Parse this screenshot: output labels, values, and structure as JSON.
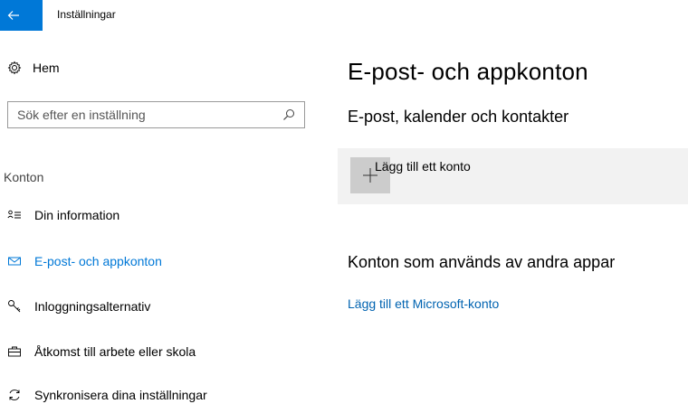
{
  "window": {
    "title": "Inställningar"
  },
  "sidebar": {
    "home_label": "Hem",
    "search_placeholder": "Sök efter en inställning",
    "section_label": "Konton",
    "items": [
      {
        "label": "Din information",
        "icon": "person-info-icon",
        "active": false
      },
      {
        "label": "E-post- och appkonton",
        "icon": "mail-icon",
        "active": true
      },
      {
        "label": "Inloggningsalternativ",
        "icon": "key-icon",
        "active": false
      },
      {
        "label": "Åtkomst till arbete eller skola",
        "icon": "briefcase-icon",
        "active": false
      },
      {
        "label": "Synkronisera dina inställningar",
        "icon": "sync-icon",
        "active": false
      }
    ]
  },
  "main": {
    "title": "E-post- och appkonton",
    "email_section_title": "E-post, kalender och kontakter",
    "add_account_label": "Lägg till ett konto",
    "other_apps_title": "Konton som används av andra appar",
    "add_ms_account_link": "Lägg till ett Microsoft-konto"
  },
  "colors": {
    "accent": "#0078d7",
    "link": "#0063b1",
    "tile_bg": "#f2f2f2",
    "plus_bg": "#cccccc"
  }
}
